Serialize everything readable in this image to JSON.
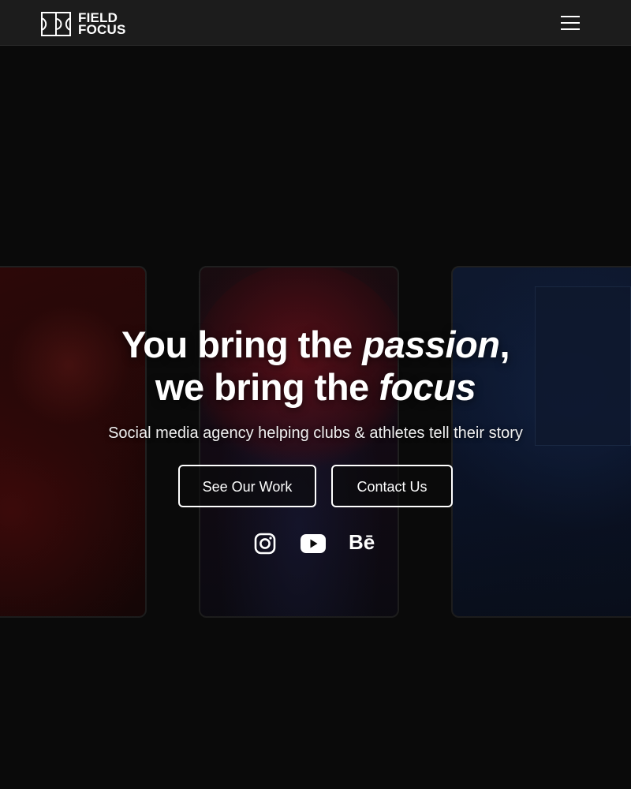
{
  "brand": {
    "name_line1": "FIELD",
    "name_line2": "FOCUS",
    "logo_icon": "field-goal-logo-icon"
  },
  "nav": {
    "menu_icon": "hamburger-menu-icon"
  },
  "hero": {
    "headline": {
      "line1_prefix": "You bring the ",
      "line1_emphasis": "passion",
      "line1_suffix": ",",
      "line2_prefix": "we bring the ",
      "line2_emphasis": "focus"
    },
    "subtitle": "Social media agency helping clubs & athletes tell their story",
    "buttons": {
      "primary_label": "See Our Work",
      "secondary_label": "Contact Us"
    },
    "social": {
      "instagram_icon": "instagram-icon",
      "youtube_icon": "youtube-icon",
      "behance_label": "Bē"
    }
  },
  "colors": {
    "background": "#0a0a0a",
    "navbar": "#1c1c1c",
    "text": "#ffffff"
  }
}
